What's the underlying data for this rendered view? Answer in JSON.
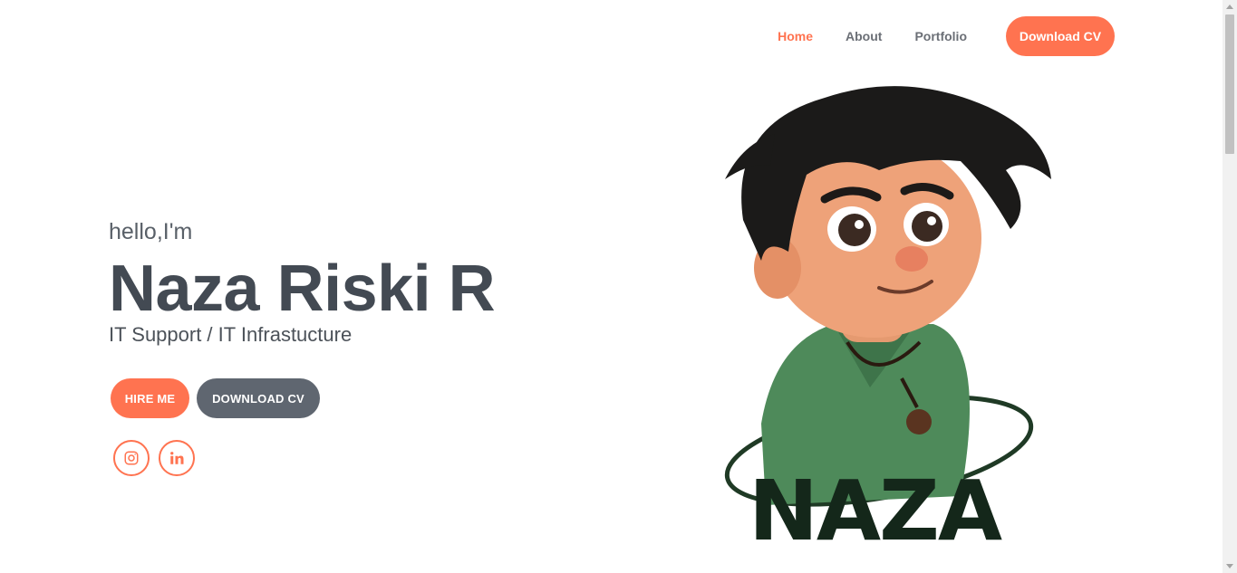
{
  "nav": {
    "links": [
      {
        "label": "Home",
        "active": true
      },
      {
        "label": "About",
        "active": false
      },
      {
        "label": "Portfolio",
        "active": false
      }
    ],
    "cta_label": "Download CV"
  },
  "hero": {
    "greeting": "hello,I'm",
    "name": "Naza Riski R",
    "role": "IT Support / IT Infrastucture",
    "hire_label": "HIRE ME",
    "download_label": "DOWNLOAD CV"
  },
  "socials": [
    {
      "icon": "instagram-icon"
    },
    {
      "icon": "linkedin-icon"
    }
  ],
  "illustration": {
    "logo_text": "NAZA"
  },
  "colors": {
    "accent": "#ff7350",
    "dark_button": "#5f6670",
    "heading": "#434a53",
    "text": "#596068"
  }
}
